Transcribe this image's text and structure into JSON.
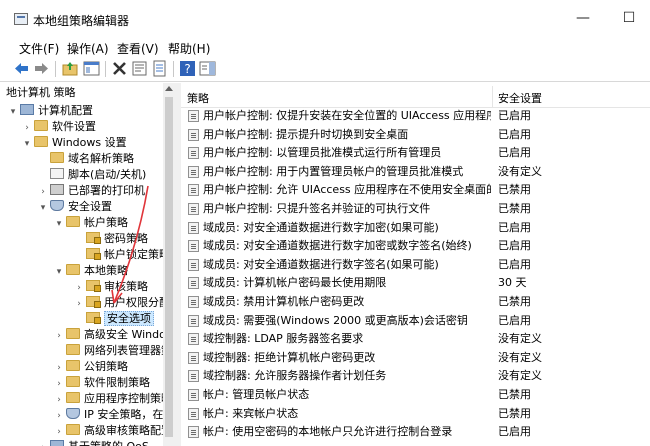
{
  "window": {
    "title": "本地组策略编辑器",
    "controls": {
      "minimize": "—",
      "maximize": "☐"
    }
  },
  "menu": [
    "文件(F)",
    "操作(A)",
    "查看(V)",
    "帮助(H)"
  ],
  "tree": {
    "header": "地计算机 策略",
    "items": [
      {
        "label": "计算机配置",
        "icon": "computer-icon",
        "exp": "▾"
      },
      {
        "label": "软件设置",
        "icon": "folder-icon",
        "exp": "›"
      },
      {
        "label": "Windows 设置",
        "icon": "folder-icon",
        "exp": "▾"
      },
      {
        "label": "域名解析策略",
        "icon": "folder-icon",
        "exp": ""
      },
      {
        "label": "脚本(启动/关机)",
        "icon": "script-icon",
        "exp": ""
      },
      {
        "label": "已部署的打印机",
        "icon": "printer-icon",
        "exp": "›"
      },
      {
        "label": "安全设置",
        "icon": "shield-icon",
        "exp": "▾"
      },
      {
        "label": "帐户策略",
        "icon": "folder-icon",
        "exp": "▾"
      },
      {
        "label": "密码策略",
        "icon": "lock-folder-icon",
        "exp": ""
      },
      {
        "label": "帐户锁定策略",
        "icon": "lock-folder-icon",
        "exp": ""
      },
      {
        "label": "本地策略",
        "icon": "folder-icon",
        "exp": "▾"
      },
      {
        "label": "审核策略",
        "icon": "lock-folder-icon",
        "exp": "›"
      },
      {
        "label": "用户权限分配",
        "icon": "lock-folder-icon",
        "exp": "›"
      },
      {
        "label": "安全选项",
        "icon": "lock-folder-icon",
        "exp": "",
        "selected": true
      },
      {
        "label": "高级安全 Windows",
        "icon": "folder-icon",
        "exp": "›"
      },
      {
        "label": "网络列表管理器策略",
        "icon": "folder-icon",
        "exp": ""
      },
      {
        "label": "公钥策略",
        "icon": "folder-icon",
        "exp": "›"
      },
      {
        "label": "软件限制策略",
        "icon": "folder-icon",
        "exp": "›"
      },
      {
        "label": "应用程序控制策略",
        "icon": "folder-icon",
        "exp": "›"
      },
      {
        "label": "IP 安全策略，在 本",
        "icon": "shield-icon",
        "exp": "›"
      },
      {
        "label": "高级审核策略配置",
        "icon": "folder-icon",
        "exp": "›"
      },
      {
        "label": "基于策略的 QoS",
        "icon": "chart-icon",
        "exp": "›"
      }
    ]
  },
  "list": {
    "col_policy": "策略",
    "col_setting": "安全设置",
    "rows": [
      {
        "policy": "用户帐户控制: 仅提升安装在安全位置的 UIAccess 应用程序",
        "setting": "已启用"
      },
      {
        "policy": "用户帐户控制: 提示提升时切换到安全桌面",
        "setting": "已启用"
      },
      {
        "policy": "用户帐户控制: 以管理员批准模式运行所有管理员",
        "setting": "已启用"
      },
      {
        "policy": "用户帐户控制: 用于内置管理员帐户的管理员批准模式",
        "setting": "没有定义"
      },
      {
        "policy": "用户帐户控制: 允许 UIAccess 应用程序在不使用安全桌面的...",
        "setting": "已禁用"
      },
      {
        "policy": "用户帐户控制: 只提升签名并验证的可执行文件",
        "setting": "已禁用"
      },
      {
        "policy": "域成员: 对安全通道数据进行数字加密(如果可能)",
        "setting": "已启用"
      },
      {
        "policy": "域成员: 对安全通道数据进行数字加密或数字签名(始终)",
        "setting": "已启用"
      },
      {
        "policy": "域成员: 对安全通道数据进行数字签名(如果可能)",
        "setting": "已启用"
      },
      {
        "policy": "域成员: 计算机帐户密码最长使用期限",
        "setting": "30 天"
      },
      {
        "policy": "域成员: 禁用计算机帐户密码更改",
        "setting": "已禁用"
      },
      {
        "policy": "域成员: 需要强(Windows 2000 或更高版本)会话密钥",
        "setting": "已启用"
      },
      {
        "policy": "域控制器: LDAP 服务器签名要求",
        "setting": "没有定义"
      },
      {
        "policy": "域控制器: 拒绝计算机帐户密码更改",
        "setting": "没有定义"
      },
      {
        "policy": "域控制器: 允许服务器操作者计划任务",
        "setting": "没有定义"
      },
      {
        "policy": "帐户: 管理员帐户状态",
        "setting": "已禁用"
      },
      {
        "policy": "帐户: 来宾帐户状态",
        "setting": "已禁用"
      },
      {
        "policy": "帐户: 使用空密码的本地帐户只允许进行控制台登录",
        "setting": "已启用"
      }
    ]
  },
  "colors": {
    "accent_arrow": "#e0353a",
    "selection": "#cce8ff"
  }
}
